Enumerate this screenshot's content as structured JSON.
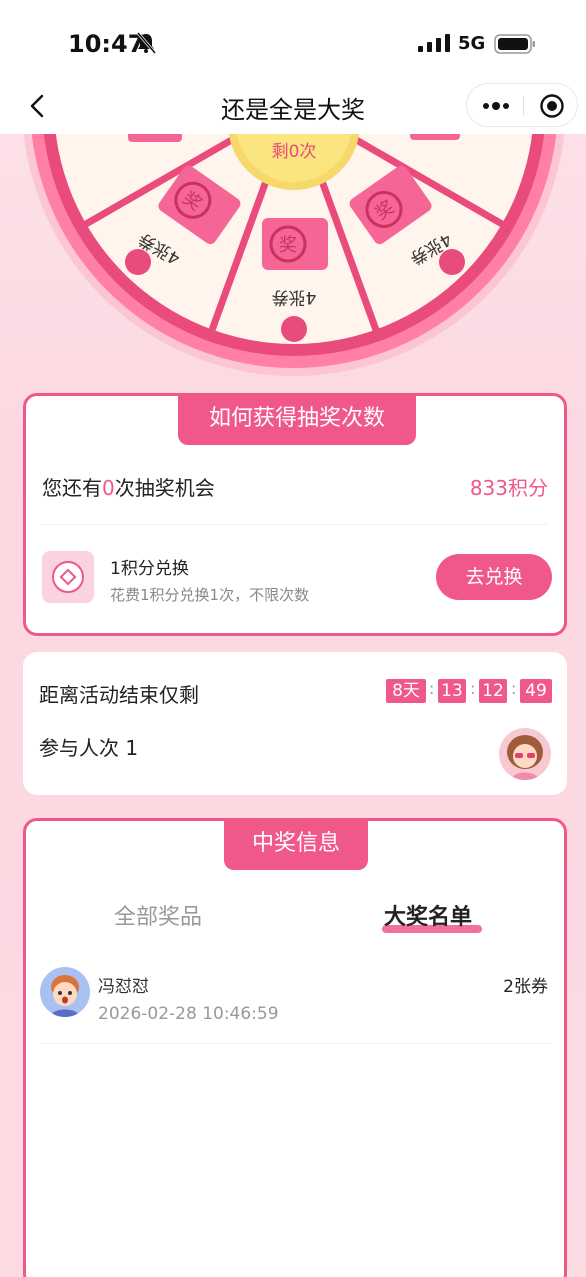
{
  "status_bar": {
    "time": "10:47",
    "network": "5G"
  },
  "nav": {
    "title": "还是全是大奖"
  },
  "wheel": {
    "center_label": "剩0次",
    "segment_labels": [
      "4张券",
      "4张券",
      "4张券"
    ]
  },
  "how_to": {
    "ribbon": "如何获得抽奖次数",
    "chances_prefix": "您还有",
    "chances_count": "0",
    "chances_suffix": "次抽奖机会",
    "points": "833积分",
    "exchange_title": "1积分兑换",
    "exchange_desc": "花费1积分兑换1次，不限次数",
    "exchange_button": "去兑换"
  },
  "activity": {
    "end_label": "距离活动结束仅剩",
    "countdown": [
      "8天",
      "13",
      "12",
      "49"
    ],
    "countdown_sep": ":",
    "participants_label": "参与人次 1"
  },
  "winners": {
    "ribbon": "中奖信息",
    "tabs": [
      "全部奖品",
      "大奖名单"
    ],
    "active_tab": "大奖名单",
    "list": [
      {
        "name": "冯怼怼",
        "time": "2026-02-28 10:46:59",
        "prize": "2张券"
      }
    ]
  },
  "colors": {
    "accent": "#f0588a",
    "wheel_gold": "#f7d86a",
    "background": "#fde4ea"
  }
}
